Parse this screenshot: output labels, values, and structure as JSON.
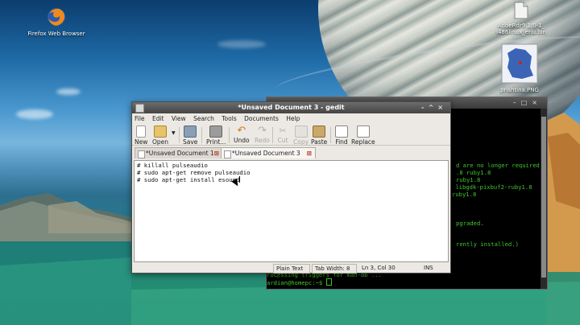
{
  "desktop": {
    "icons": [
      {
        "label": "Firefox Web Browser",
        "icon": "firefox-icon"
      },
      {
        "label": "AdbeRdr9.1.0-1_",
        "label2": "i486linux_enu.bin",
        "icon": "file-icon"
      },
      {
        "label": "prishtina.PNG",
        "icon": "image-icon"
      }
    ]
  },
  "terminal": {
    "lines": [
      "d are no longer required:",
      ".8 ruby1.8",
      "ruby1.8",
      " libgdk-pixbuf2-ruby1.8",
      "ruby1.8",
      "pgraded.",
      "rently installed.)",
      "rocessing triggers for man-db ...",
      "ardian@homepc:~$ "
    ]
  },
  "gedit": {
    "title": "*Unsaved Document 3 - gedit",
    "menu": [
      "File",
      "Edit",
      "View",
      "Search",
      "Tools",
      "Documents",
      "Help"
    ],
    "toolbar": {
      "new": "New",
      "open": "Open",
      "save": "Save",
      "print": "Print...",
      "undo": "Undo",
      "redo": "Redo",
      "cut": "Cut",
      "copy": "Copy",
      "paste": "Paste",
      "find": "Find",
      "replace": "Replace"
    },
    "tabs": [
      "*Unsaved Document 1",
      "*Unsaved Document 3"
    ],
    "lines": [
      "# killall pulseaudio",
      "# sudo apt-get remove pulseaudio",
      "# sudo apt-get install esound"
    ],
    "status": {
      "mode": "Plain Text",
      "tab_width": "Tab Width:  8",
      "position": "Ln 3, Col 30",
      "ins": "INS"
    }
  },
  "colors": {
    "terminal_text": "#41c631",
    "close_tab": "#c0392b"
  }
}
